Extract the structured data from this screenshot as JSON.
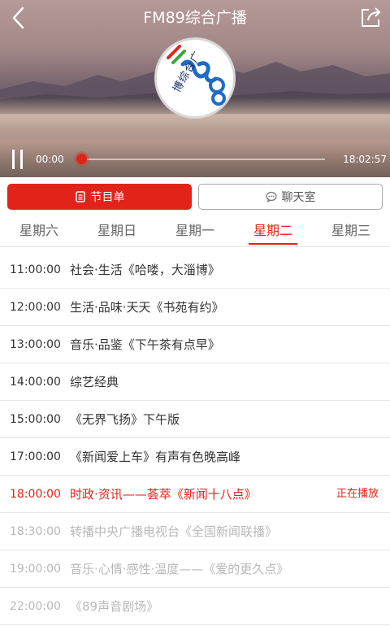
{
  "header": {
    "title": "FM89综合广播",
    "back_icon": "chevron-left-icon",
    "share_icon": "share-icon"
  },
  "logo": {
    "text": "博综合广"
  },
  "player": {
    "current_time": "00:00",
    "total_time": "18:02:57",
    "progress": 0.0,
    "accent_color": "#e2231a"
  },
  "buttons": {
    "schedule_label": "节目单",
    "chat_label": "聊天室"
  },
  "days": [
    {
      "label": "星期六"
    },
    {
      "label": "星期日"
    },
    {
      "label": "星期一"
    },
    {
      "label": "星期二"
    },
    {
      "label": "星期三"
    }
  ],
  "active_day": 3,
  "programs": [
    {
      "time": "11:00:00",
      "name": "社会·生活《哈喽，大淄博》",
      "status": ""
    },
    {
      "time": "12:00:00",
      "name": "生活·品味·天天《书苑有约》",
      "status": ""
    },
    {
      "time": "13:00:00",
      "name": "音乐·品鉴《下午茶有点早》",
      "status": ""
    },
    {
      "time": "14:00:00",
      "name": "综艺经典",
      "status": ""
    },
    {
      "time": "15:00:00",
      "name": "《无界飞扬》下午版",
      "status": ""
    },
    {
      "time": "17:00:00",
      "name": "《新闻爱上车》有声有色晚高峰",
      "status": ""
    },
    {
      "time": "18:00:00",
      "name": "时政·资讯——荟萃《新闻十八点》",
      "status": "正在播放"
    },
    {
      "time": "18:30:00",
      "name": "转播中央广播电视台《全国新闻联播》",
      "status": ""
    },
    {
      "time": "19:00:00",
      "name": "音乐·心情·感性·温度——《爱的更久点》",
      "status": ""
    },
    {
      "time": "22:00:00",
      "name": "《89声音剧场》",
      "status": ""
    }
  ]
}
